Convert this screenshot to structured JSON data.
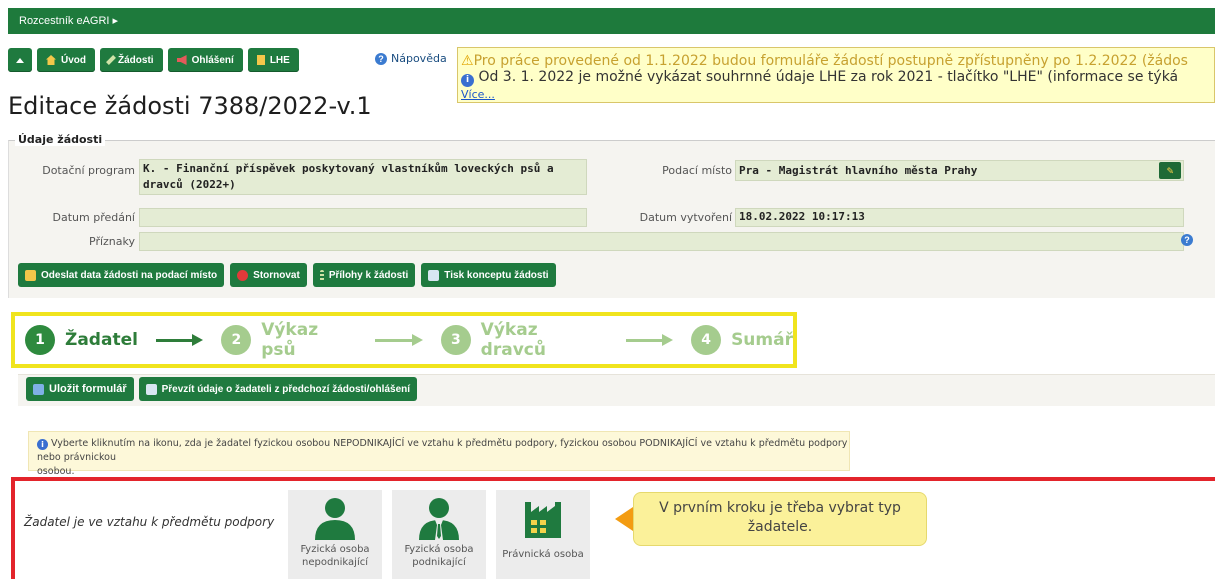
{
  "topbar": {
    "crumb": "Rozcestník eAGRI ▸"
  },
  "nav": {
    "items": [
      {
        "label": "Úvod",
        "icon": "home-icon"
      },
      {
        "label": "Žádosti",
        "icon": "pen-icon"
      },
      {
        "label": "Ohlášení",
        "icon": "megaphone-icon"
      },
      {
        "label": "LHE",
        "icon": "document-icon"
      }
    ],
    "help": "Nápověda"
  },
  "notice": {
    "line1": "Pro práce provedené od 1.1.2022 budou formuláře žádostí postupně zpřístupněny po 1.2.2022 (žádos",
    "line2": "Od 3. 1. 2022 je možné vykázat souhrnné údaje LHE za rok 2021 - tlačítko \"LHE\" (informace se týká",
    "more": "Více..."
  },
  "page": {
    "title": "Editace žádosti 7388/2022-v.1"
  },
  "details": {
    "legend": "Údaje žádosti",
    "dotacni_label": "Dotační program",
    "dotacni_value_1": "K. - Finanční příspěvek poskytovaný vlastníkům loveckých psů a",
    "dotacni_value_2": "dravců (2022+)",
    "podaci_label": "Podací místo",
    "podaci_value": "Pra - Magistrát hlavního města Prahy",
    "predani_label": "Datum předání",
    "predani_value": "",
    "vytvoreni_label": "Datum vytvoření",
    "vytvoreni_value": "18.02.2022 10:17:13",
    "priznaky_label": "Příznaky",
    "priznaky_value": ""
  },
  "actions": {
    "send": "Odeslat data žádosti na podací místo",
    "cancel": "Stornovat",
    "attachments": "Přílohy k žádosti",
    "print": "Tisk konceptu žádosti"
  },
  "steps": [
    {
      "num": "1",
      "label": "Žadatel"
    },
    {
      "num": "2",
      "label": "Výkaz psů"
    },
    {
      "num": "3",
      "label": "Výkaz dravců"
    },
    {
      "num": "4",
      "label": "Sumář"
    }
  ],
  "form": {
    "save": "Uložit formulář",
    "import": "Převzít údaje o žadateli z předchozí žádosti/ohlášení"
  },
  "hint": {
    "line1": "Vyberte kliknutím na ikonu, zda je žadatel fyzickou osobou NEPODNIKAJÍCÍ ve vztahu k předmětu podpory, fyzickou osobou PODNIKAJÍCÍ ve vztahu k předmětu podpory nebo právnickou",
    "line2": "osobou."
  },
  "chooser": {
    "text": "Žadatel je ve vztahu k předmětu podpory",
    "tiles": [
      {
        "line1": "Fyzická osoba",
        "line2": "nepodnikající"
      },
      {
        "line1": "Fyzická osoba",
        "line2": "podnikající"
      },
      {
        "line1": "Právnická osoba",
        "line2": ""
      }
    ],
    "callout_1": "V prvním kroku je třeba vybrat typ",
    "callout_2": "žadatele."
  },
  "colors": {
    "brand_green": "#1f7a3f",
    "step_active": "#2e8a3e",
    "step_dim": "#a5cc8e",
    "highlight_yellow": "#f0e41d",
    "highlight_red": "#e3242b"
  }
}
